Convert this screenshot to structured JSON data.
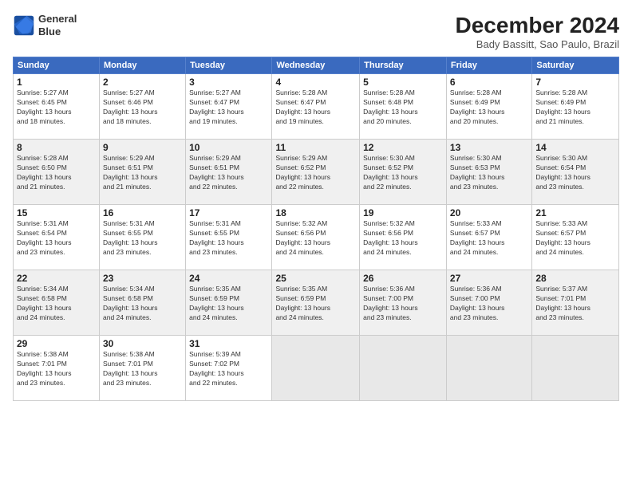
{
  "logo": {
    "line1": "General",
    "line2": "Blue"
  },
  "title": "December 2024",
  "subtitle": "Bady Bassitt, Sao Paulo, Brazil",
  "days_header": [
    "Sunday",
    "Monday",
    "Tuesday",
    "Wednesday",
    "Thursday",
    "Friday",
    "Saturday"
  ],
  "weeks": [
    [
      {
        "day": "1",
        "info": "Sunrise: 5:27 AM\nSunset: 6:45 PM\nDaylight: 13 hours\nand 18 minutes."
      },
      {
        "day": "2",
        "info": "Sunrise: 5:27 AM\nSunset: 6:46 PM\nDaylight: 13 hours\nand 18 minutes."
      },
      {
        "day": "3",
        "info": "Sunrise: 5:27 AM\nSunset: 6:47 PM\nDaylight: 13 hours\nand 19 minutes."
      },
      {
        "day": "4",
        "info": "Sunrise: 5:28 AM\nSunset: 6:47 PM\nDaylight: 13 hours\nand 19 minutes."
      },
      {
        "day": "5",
        "info": "Sunrise: 5:28 AM\nSunset: 6:48 PM\nDaylight: 13 hours\nand 20 minutes."
      },
      {
        "day": "6",
        "info": "Sunrise: 5:28 AM\nSunset: 6:49 PM\nDaylight: 13 hours\nand 20 minutes."
      },
      {
        "day": "7",
        "info": "Sunrise: 5:28 AM\nSunset: 6:49 PM\nDaylight: 13 hours\nand 21 minutes."
      }
    ],
    [
      {
        "day": "8",
        "info": "Sunrise: 5:28 AM\nSunset: 6:50 PM\nDaylight: 13 hours\nand 21 minutes."
      },
      {
        "day": "9",
        "info": "Sunrise: 5:29 AM\nSunset: 6:51 PM\nDaylight: 13 hours\nand 21 minutes."
      },
      {
        "day": "10",
        "info": "Sunrise: 5:29 AM\nSunset: 6:51 PM\nDaylight: 13 hours\nand 22 minutes."
      },
      {
        "day": "11",
        "info": "Sunrise: 5:29 AM\nSunset: 6:52 PM\nDaylight: 13 hours\nand 22 minutes."
      },
      {
        "day": "12",
        "info": "Sunrise: 5:30 AM\nSunset: 6:52 PM\nDaylight: 13 hours\nand 22 minutes."
      },
      {
        "day": "13",
        "info": "Sunrise: 5:30 AM\nSunset: 6:53 PM\nDaylight: 13 hours\nand 23 minutes."
      },
      {
        "day": "14",
        "info": "Sunrise: 5:30 AM\nSunset: 6:54 PM\nDaylight: 13 hours\nand 23 minutes."
      }
    ],
    [
      {
        "day": "15",
        "info": "Sunrise: 5:31 AM\nSunset: 6:54 PM\nDaylight: 13 hours\nand 23 minutes."
      },
      {
        "day": "16",
        "info": "Sunrise: 5:31 AM\nSunset: 6:55 PM\nDaylight: 13 hours\nand 23 minutes."
      },
      {
        "day": "17",
        "info": "Sunrise: 5:31 AM\nSunset: 6:55 PM\nDaylight: 13 hours\nand 23 minutes."
      },
      {
        "day": "18",
        "info": "Sunrise: 5:32 AM\nSunset: 6:56 PM\nDaylight: 13 hours\nand 24 minutes."
      },
      {
        "day": "19",
        "info": "Sunrise: 5:32 AM\nSunset: 6:56 PM\nDaylight: 13 hours\nand 24 minutes."
      },
      {
        "day": "20",
        "info": "Sunrise: 5:33 AM\nSunset: 6:57 PM\nDaylight: 13 hours\nand 24 minutes."
      },
      {
        "day": "21",
        "info": "Sunrise: 5:33 AM\nSunset: 6:57 PM\nDaylight: 13 hours\nand 24 minutes."
      }
    ],
    [
      {
        "day": "22",
        "info": "Sunrise: 5:34 AM\nSunset: 6:58 PM\nDaylight: 13 hours\nand 24 minutes."
      },
      {
        "day": "23",
        "info": "Sunrise: 5:34 AM\nSunset: 6:58 PM\nDaylight: 13 hours\nand 24 minutes."
      },
      {
        "day": "24",
        "info": "Sunrise: 5:35 AM\nSunset: 6:59 PM\nDaylight: 13 hours\nand 24 minutes."
      },
      {
        "day": "25",
        "info": "Sunrise: 5:35 AM\nSunset: 6:59 PM\nDaylight: 13 hours\nand 24 minutes."
      },
      {
        "day": "26",
        "info": "Sunrise: 5:36 AM\nSunset: 7:00 PM\nDaylight: 13 hours\nand 23 minutes."
      },
      {
        "day": "27",
        "info": "Sunrise: 5:36 AM\nSunset: 7:00 PM\nDaylight: 13 hours\nand 23 minutes."
      },
      {
        "day": "28",
        "info": "Sunrise: 5:37 AM\nSunset: 7:01 PM\nDaylight: 13 hours\nand 23 minutes."
      }
    ],
    [
      {
        "day": "29",
        "info": "Sunrise: 5:38 AM\nSunset: 7:01 PM\nDaylight: 13 hours\nand 23 minutes."
      },
      {
        "day": "30",
        "info": "Sunrise: 5:38 AM\nSunset: 7:01 PM\nDaylight: 13 hours\nand 23 minutes."
      },
      {
        "day": "31",
        "info": "Sunrise: 5:39 AM\nSunset: 7:02 PM\nDaylight: 13 hours\nand 22 minutes."
      },
      {
        "day": "",
        "info": ""
      },
      {
        "day": "",
        "info": ""
      },
      {
        "day": "",
        "info": ""
      },
      {
        "day": "",
        "info": ""
      }
    ]
  ]
}
